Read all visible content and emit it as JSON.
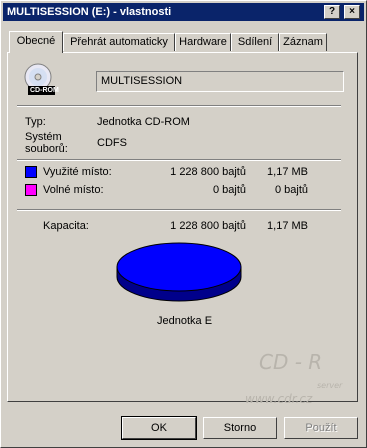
{
  "window": {
    "title": "MULTISESSION (E:) - vlastnosti",
    "help_btn": "?",
    "close_btn": "×"
  },
  "tabs": [
    {
      "label": "Obecné"
    },
    {
      "label": "Přehrát automaticky"
    },
    {
      "label": "Hardware"
    },
    {
      "label": "Sdílení"
    },
    {
      "label": "Záznam"
    }
  ],
  "drive": {
    "icon": "cd-rom-icon",
    "icon_label": "CD-ROM",
    "name": "MULTISESSION",
    "type_label": "Typ:",
    "type_value": "Jednotka CD-ROM",
    "fs_label_1": "Systém",
    "fs_label_2": "souborů:",
    "fs_value": "CDFS"
  },
  "used": {
    "label": "Využité místo:",
    "bytes": "1 228 800 bajtů",
    "size": "1,17 MB",
    "color": "#0000ff"
  },
  "free": {
    "label": "Volné místo:",
    "bytes": "0 bajtů",
    "size": "0 bajtů",
    "color": "#ff00ff"
  },
  "capacity": {
    "label": "Kapacita:",
    "bytes": "1 228 800 bajtů",
    "size": "1,17 MB"
  },
  "pie": {
    "used_fraction": 1.0,
    "color_top": "#0000ff",
    "color_side": "#00008b"
  },
  "drive_caption": "Jednotka E",
  "watermark": {
    "logo": "CD - R",
    "sub": "server",
    "url": "www.cdr.cz"
  },
  "buttons": {
    "ok": "OK",
    "cancel": "Storno",
    "apply": "Použít"
  }
}
